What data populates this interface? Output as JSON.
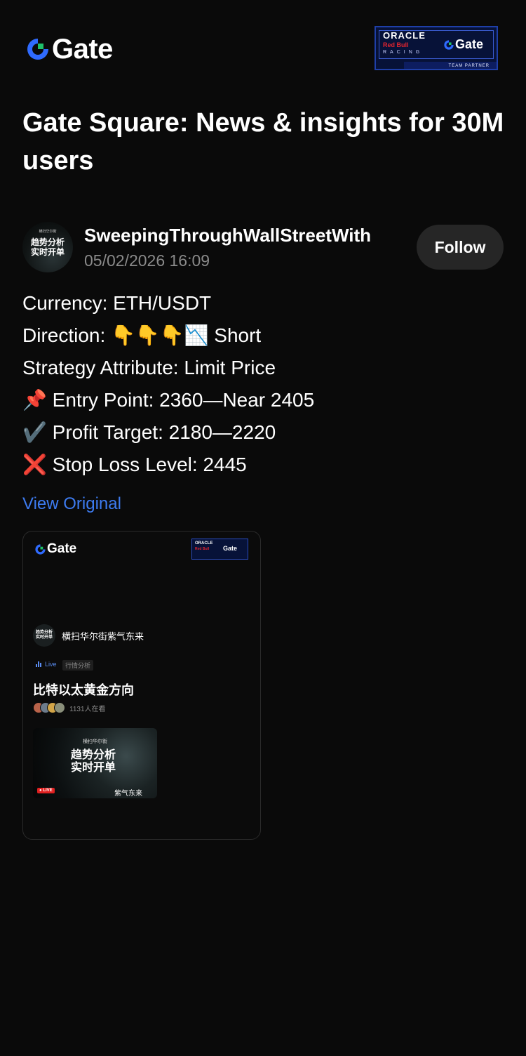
{
  "brand": {
    "logo_text": "Gate",
    "colors": {
      "background": "#0a0a0a",
      "accent": "#3d7bf0",
      "logo_blue": "#2f6bff",
      "logo_green": "#1ec26b"
    }
  },
  "partner_badge": {
    "line1": "ORACLE",
    "line2": "Red Bull",
    "line3": "RACING",
    "gate_text": "Gate",
    "caption": "TEAM PARTNER"
  },
  "page": {
    "title": "Gate Square: News & insights for 30M users"
  },
  "post": {
    "author": "SweepingThroughWallStreetWith",
    "avatar_text_top": "横扫华尔街",
    "avatar_text": "趋势分析\n实时开单",
    "timestamp": "05/02/2026 16:09",
    "follow_label": "Follow",
    "lines": [
      "Currency: ETH/USDT",
      "Direction: 👇👇👇📉 Short",
      "Strategy Attribute: Limit Price",
      "📌 Entry Point: 2360—Near 2405",
      "✔️ Profit Target: 2180—2220",
      "❌ Stop Loss Level: 2445"
    ],
    "view_original": "View Original"
  },
  "card": {
    "logo_text": "Gate",
    "partner_line1": "ORACLE",
    "partner_line2": "Red Bull",
    "partner_gate": "Gate",
    "avatar_text": "趋势分析\n实时开单",
    "author": "横扫华尔街紫气东来",
    "live_label": "Live",
    "tag": "行情分析",
    "title": "比特以太黄金方向",
    "viewers": "1131人在看",
    "thumb_top": "横扫华尔街",
    "thumb_main": "趋势分析\n实时开单",
    "thumb_live": "● LIVE",
    "thumb_bottom": "紫气东来"
  }
}
